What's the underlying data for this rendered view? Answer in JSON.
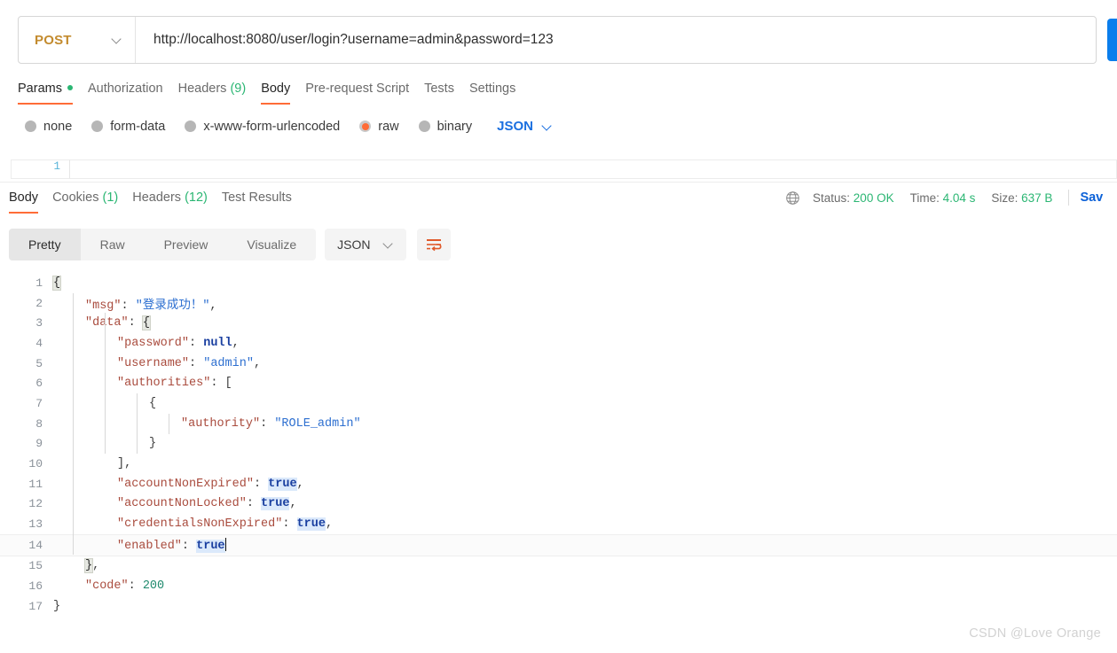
{
  "request": {
    "method": "POST",
    "url": "http://localhost:8080/user/login?username=admin&password=123",
    "send_label": "",
    "tabs": [
      {
        "label": "Params",
        "badge": "",
        "dot": true,
        "active": false
      },
      {
        "label": "Authorization",
        "badge": "",
        "dot": false,
        "active": false
      },
      {
        "label": "Headers",
        "badge": "(9)",
        "dot": false,
        "active": false
      },
      {
        "label": "Body",
        "badge": "",
        "dot": false,
        "active": true
      },
      {
        "label": "Pre-request Script",
        "badge": "",
        "dot": false,
        "active": false
      },
      {
        "label": "Tests",
        "badge": "",
        "dot": false,
        "active": false
      },
      {
        "label": "Settings",
        "badge": "",
        "dot": false,
        "active": false
      }
    ],
    "body_types": [
      {
        "label": "none",
        "selected": false
      },
      {
        "label": "form-data",
        "selected": false
      },
      {
        "label": "x-www-form-urlencoded",
        "selected": false
      },
      {
        "label": "raw",
        "selected": true
      },
      {
        "label": "binary",
        "selected": false
      }
    ],
    "body_format": "JSON",
    "editor_line_number": "1",
    "editor_content": ""
  },
  "response": {
    "tabs": [
      {
        "label": "Body",
        "badge": "",
        "active": true
      },
      {
        "label": "Cookies",
        "badge": "(1)",
        "active": false
      },
      {
        "label": "Headers",
        "badge": "(12)",
        "active": false
      },
      {
        "label": "Test Results",
        "badge": "",
        "active": false
      }
    ],
    "status_label": "Status:",
    "status_value": "200 OK",
    "time_label": "Time:",
    "time_value": "4.04 s",
    "size_label": "Size:",
    "size_value": "637 B",
    "save_label": "Sav",
    "view_modes": [
      {
        "label": "Pretty",
        "active": true
      },
      {
        "label": "Raw",
        "active": false
      },
      {
        "label": "Preview",
        "active": false
      },
      {
        "label": "Visualize",
        "active": false
      }
    ],
    "format": "JSON",
    "body_lines": [
      {
        "n": "1",
        "active": false
      },
      {
        "n": "2",
        "active": false
      },
      {
        "n": "3",
        "active": false
      },
      {
        "n": "4",
        "active": false
      },
      {
        "n": "5",
        "active": false
      },
      {
        "n": "6",
        "active": false
      },
      {
        "n": "7",
        "active": false
      },
      {
        "n": "8",
        "active": false
      },
      {
        "n": "9",
        "active": false
      },
      {
        "n": "10",
        "active": false
      },
      {
        "n": "11",
        "active": false
      },
      {
        "n": "12",
        "active": false
      },
      {
        "n": "13",
        "active": false
      },
      {
        "n": "14",
        "active": true
      },
      {
        "n": "15",
        "active": false
      },
      {
        "n": "16",
        "active": false
      },
      {
        "n": "17",
        "active": false
      }
    ],
    "body_json": {
      "msg": "登录成功！",
      "data": {
        "password": null,
        "username": "admin",
        "authorities": [
          {
            "authority": "ROLE_admin"
          }
        ],
        "accountNonExpired": true,
        "accountNonLocked": true,
        "credentialsNonExpired": true,
        "enabled": true
      },
      "code": 200
    },
    "body_tokens": {
      "l1": [
        {
          "t": "{",
          "c": "brk-hl"
        }
      ],
      "l2": [
        {
          "t": "\"msg\"",
          "c": "k"
        },
        {
          "t": ": ",
          "c": "p"
        },
        {
          "t": "\"登录成功！\"",
          "c": "s"
        },
        {
          "t": ",",
          "c": "p"
        }
      ],
      "l3": [
        {
          "t": "\"data\"",
          "c": "k"
        },
        {
          "t": ": ",
          "c": "p"
        },
        {
          "t": "{",
          "c": "brk-hl"
        }
      ],
      "l4": [
        {
          "t": "\"password\"",
          "c": "k"
        },
        {
          "t": ": ",
          "c": "p"
        },
        {
          "t": "null",
          "c": "n"
        },
        {
          "t": ",",
          "c": "p"
        }
      ],
      "l5": [
        {
          "t": "\"username\"",
          "c": "k"
        },
        {
          "t": ": ",
          "c": "p"
        },
        {
          "t": "\"admin\"",
          "c": "s"
        },
        {
          "t": ",",
          "c": "p"
        }
      ],
      "l6": [
        {
          "t": "\"authorities\"",
          "c": "k"
        },
        {
          "t": ": [",
          "c": "p"
        }
      ],
      "l7": [
        {
          "t": "{",
          "c": "p"
        }
      ],
      "l8": [
        {
          "t": "\"authority\"",
          "c": "k"
        },
        {
          "t": ": ",
          "c": "p"
        },
        {
          "t": "\"ROLE_admin\"",
          "c": "s"
        }
      ],
      "l9": [
        {
          "t": "}",
          "c": "p"
        }
      ],
      "l10": [
        {
          "t": "],",
          "c": "p"
        }
      ],
      "l11": [
        {
          "t": "\"accountNonExpired\"",
          "c": "k"
        },
        {
          "t": ": ",
          "c": "p"
        },
        {
          "t": "true",
          "c": "b"
        },
        {
          "t": ",",
          "c": "p"
        }
      ],
      "l12": [
        {
          "t": "\"accountNonLocked\"",
          "c": "k"
        },
        {
          "t": ": ",
          "c": "p"
        },
        {
          "t": "true",
          "c": "b"
        },
        {
          "t": ",",
          "c": "p"
        }
      ],
      "l13": [
        {
          "t": "\"credentialsNonExpired\"",
          "c": "k"
        },
        {
          "t": ": ",
          "c": "p"
        },
        {
          "t": "true",
          "c": "b"
        },
        {
          "t": ",",
          "c": "p"
        }
      ],
      "l14": [
        {
          "t": "\"enabled\"",
          "c": "k"
        },
        {
          "t": ": ",
          "c": "p"
        },
        {
          "t": "true",
          "c": "b"
        }
      ],
      "l15": [
        {
          "t": "}",
          "c": "brk-hl"
        },
        {
          "t": ",",
          "c": "p"
        }
      ],
      "l16": [
        {
          "t": "\"code\"",
          "c": "k"
        },
        {
          "t": ": ",
          "c": "p"
        },
        {
          "t": "200",
          "c": "num"
        }
      ],
      "l17": [
        {
          "t": "}",
          "c": "p"
        }
      ]
    },
    "indents": {
      "l1": 0,
      "l2": 1,
      "l3": 1,
      "l4": 2,
      "l5": 2,
      "l6": 2,
      "l7": 3,
      "l8": 4,
      "l9": 3,
      "l10": 2,
      "l11": 2,
      "l12": 2,
      "l13": 2,
      "l14": 2,
      "l15": 1,
      "l16": 1,
      "l17": 0
    }
  },
  "watermark": "CSDN @Love Orange",
  "colors": {
    "accent": "#ff6c37",
    "blue": "#1a6fe0",
    "green": "#2bb673",
    "method": "#c38b2e"
  }
}
